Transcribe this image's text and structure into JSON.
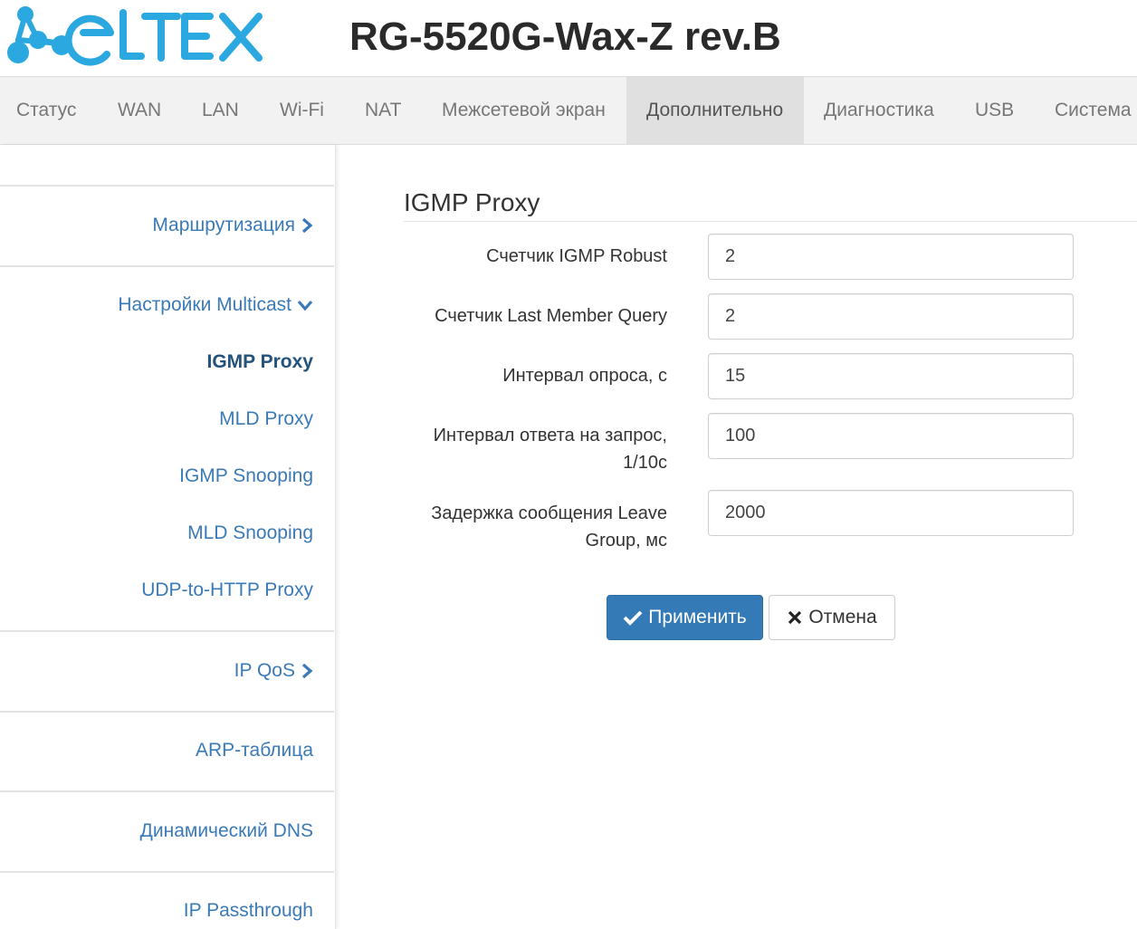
{
  "brand": {
    "logo_text": "ELTEX",
    "accent_color": "#2aa8df"
  },
  "header": {
    "device_title": "RG-5520G-Wax-Z rev.B"
  },
  "nav": {
    "items": [
      {
        "label": "Статус"
      },
      {
        "label": "WAN"
      },
      {
        "label": "LAN"
      },
      {
        "label": "Wi-Fi"
      },
      {
        "label": "NAT"
      },
      {
        "label": "Межсетевой экран"
      },
      {
        "label": "Дополнительно",
        "active": true
      },
      {
        "label": "Диагностика"
      },
      {
        "label": "USB"
      },
      {
        "label": "Система"
      }
    ]
  },
  "sidebar": {
    "items": [
      {
        "label": "Маршрутизация",
        "icon": "chevron-right-icon"
      },
      {
        "label": "Настройки Multicast",
        "icon": "chevron-down-icon"
      },
      {
        "label": "IGMP Proxy",
        "active": true
      },
      {
        "label": "MLD Proxy"
      },
      {
        "label": "IGMP Snooping"
      },
      {
        "label": "MLD Snooping"
      },
      {
        "label": "UDP-to-HTTP Proxy"
      },
      {
        "label": "IP QoS",
        "icon": "chevron-right-icon"
      },
      {
        "label": "ARP-таблица"
      },
      {
        "label": "Динамический DNS"
      },
      {
        "label": "IP Passthrough"
      }
    ]
  },
  "main": {
    "title": "IGMP Proxy",
    "fields": [
      {
        "label": "Счетчик IGMP Robust",
        "value": "2"
      },
      {
        "label": "Счетчик Last Member Query",
        "value": "2"
      },
      {
        "label": "Интервал опроса, с",
        "value": "15"
      },
      {
        "label_line1": "Интервал ответа на запрос,",
        "label_line2": "1/10с",
        "value": "100"
      },
      {
        "label_line1": "Задержка сообщения Leave",
        "label_line2": "Group, мс",
        "value": "2000"
      }
    ],
    "apply_label": "Применить",
    "cancel_label": "Отмена"
  }
}
